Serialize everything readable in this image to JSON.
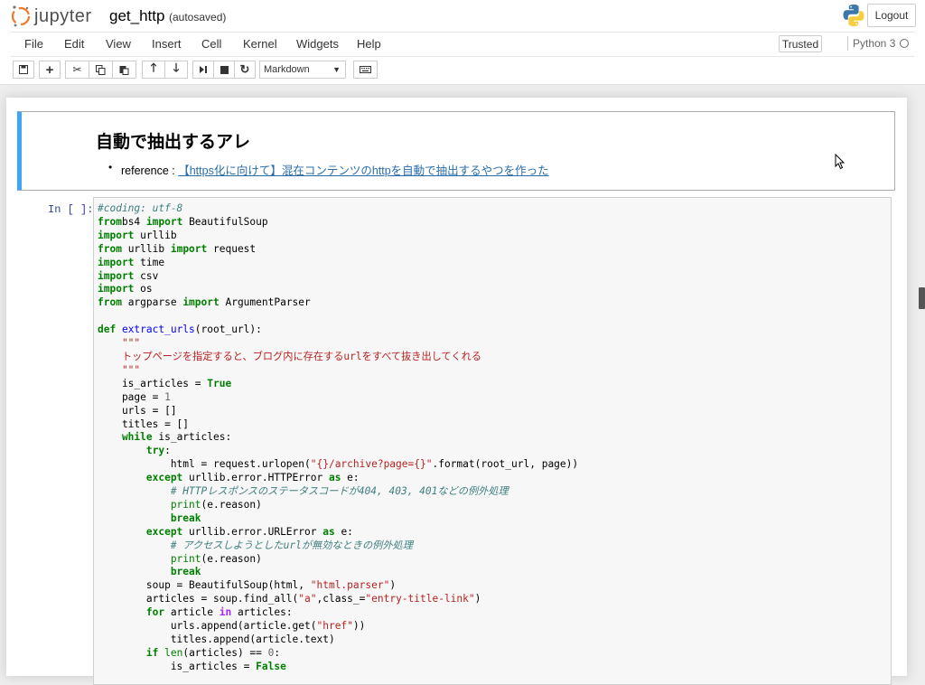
{
  "header": {
    "logo_text": "jupyter",
    "notebook_title": "get_http",
    "autosave_status": "(autosaved)",
    "logout_label": "Logout"
  },
  "menubar": {
    "items": [
      "File",
      "Edit",
      "View",
      "Insert",
      "Cell",
      "Kernel",
      "Widgets",
      "Help"
    ],
    "trusted_label": "Trusted",
    "kernel_name": "Python 3"
  },
  "toolbar": {
    "cell_type": "Markdown"
  },
  "markdown_cell": {
    "heading": "自動で抽出するアレ",
    "list_prefix": "reference : ",
    "link_text": "【https化に向けて】混在コンテンツのhttpを自動で抽出するやつを作った"
  },
  "code_cell": {
    "prompt": "In [ ]:",
    "lines": [
      [
        [
          "cm",
          "#coding: utf-8"
        ]
      ],
      [
        [
          "kw",
          "from"
        ],
        [
          "",
          "bs4 "
        ],
        [
          "kw",
          "import"
        ],
        [
          "",
          " BeautifulSoup"
        ]
      ],
      [
        [
          "kw",
          "import"
        ],
        [
          "",
          " urllib"
        ]
      ],
      [
        [
          "kw",
          "from"
        ],
        [
          "",
          " urllib "
        ],
        [
          "kw",
          "import"
        ],
        [
          "",
          " request"
        ]
      ],
      [
        [
          "kw",
          "import"
        ],
        [
          "",
          " time"
        ]
      ],
      [
        [
          "kw",
          "import"
        ],
        [
          "",
          " csv"
        ]
      ],
      [
        [
          "kw",
          "import"
        ],
        [
          "",
          " os"
        ]
      ],
      [
        [
          "kw",
          "from"
        ],
        [
          "",
          " argparse "
        ],
        [
          "kw",
          "import"
        ],
        [
          "",
          " ArgumentParser"
        ]
      ],
      [],
      [
        [
          "kw",
          "def"
        ],
        [
          "",
          ""
        ],
        [
          "fn",
          " extract_urls"
        ],
        [
          "",
          "(root_url):"
        ]
      ],
      [
        [
          "st",
          "    \"\"\""
        ]
      ],
      [
        [
          "st",
          "    トップページを指定すると、ブログ内に存在するurlをすべて抜き出してくれる"
        ]
      ],
      [
        [
          "st",
          "    \"\"\""
        ]
      ],
      [
        [
          "",
          "    is_articles = "
        ],
        [
          "kw",
          "True"
        ]
      ],
      [
        [
          "",
          "    page = "
        ],
        [
          "nm",
          "1"
        ]
      ],
      [
        [
          "",
          "    urls = []"
        ]
      ],
      [
        [
          "",
          "    titles = []"
        ]
      ],
      [
        [
          "kw",
          "    while"
        ],
        [
          "",
          " is_articles:"
        ]
      ],
      [
        [
          "kw",
          "        try"
        ],
        [
          "",
          ":"
        ]
      ],
      [
        [
          "",
          "            html = request.urlopen("
        ],
        [
          "st",
          "\"{}/archive?page={}\""
        ],
        [
          "",
          ".format(root_url, page))"
        ]
      ],
      [
        [
          "kw",
          "        except"
        ],
        [
          "",
          " urllib.error.HTTPError "
        ],
        [
          "kw",
          "as"
        ],
        [
          "",
          " e:"
        ]
      ],
      [
        [
          "cm",
          "            # HTTPレスポンスのステータスコードが404, 403, 401などの例外処理"
        ]
      ],
      [
        [
          "bi",
          "            print"
        ],
        [
          "",
          "(e.reason)"
        ]
      ],
      [
        [
          "kw",
          "            break"
        ]
      ],
      [
        [
          "kw",
          "        except"
        ],
        [
          "",
          " urllib.error.URLError "
        ],
        [
          "kw",
          "as"
        ],
        [
          "",
          " e:"
        ]
      ],
      [
        [
          "cm",
          "            # アクセスしようとしたurlが無効なときの例外処理"
        ]
      ],
      [
        [
          "bi",
          "            print"
        ],
        [
          "",
          "(e.reason)"
        ]
      ],
      [
        [
          "kw",
          "            break"
        ]
      ],
      [
        [
          "",
          "        soup = BeautifulSoup(html, "
        ],
        [
          "st",
          "\"html.parser\""
        ],
        [
          "",
          ")"
        ]
      ],
      [
        [
          "",
          "        articles = soup.find_all("
        ],
        [
          "st",
          "\"a\""
        ],
        [
          "",
          ",class_="
        ],
        [
          "st",
          "\"entry-title-link\""
        ],
        [
          "",
          ")"
        ]
      ],
      [
        [
          "kw",
          "        for"
        ],
        [
          "",
          " article "
        ],
        [
          "op",
          "in"
        ],
        [
          "",
          " articles:"
        ]
      ],
      [
        [
          "",
          "            urls.append(article.get("
        ],
        [
          "st",
          "\"href\""
        ],
        [
          "",
          "))"
        ]
      ],
      [
        [
          "",
          "            titles.append(article.text)"
        ]
      ],
      [
        [
          "kw",
          "        if"
        ],
        [
          "",
          " "
        ],
        [
          "bi",
          "len"
        ],
        [
          "",
          "(articles) == "
        ],
        [
          "nm",
          "0"
        ],
        [
          "",
          ":"
        ]
      ],
      [
        [
          "",
          "            is_articles = "
        ],
        [
          "kw",
          "False"
        ]
      ]
    ]
  }
}
